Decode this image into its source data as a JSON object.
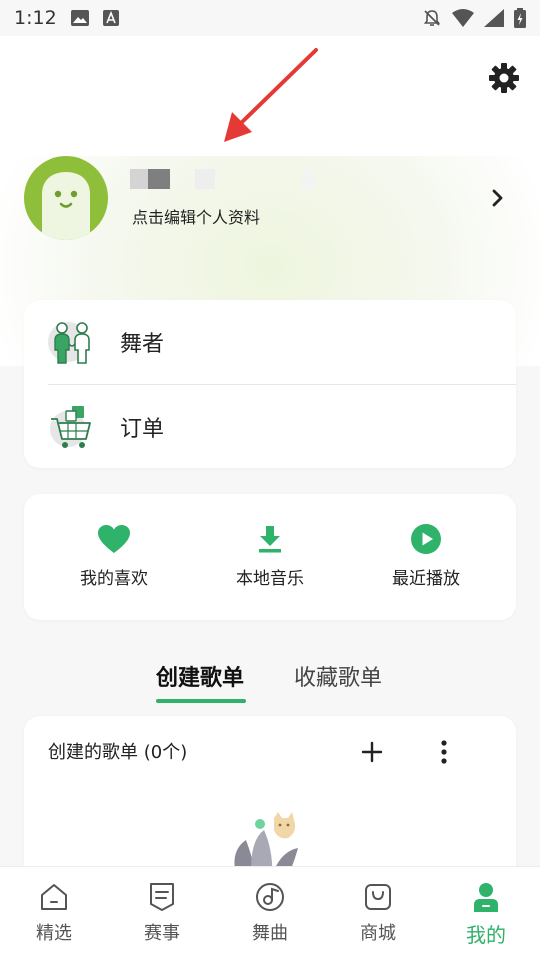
{
  "status_bar": {
    "time": "1:12"
  },
  "profile": {
    "subtitle": "点击编辑个人资料"
  },
  "list_card": {
    "items": [
      {
        "label": "舞者"
      },
      {
        "label": "订单"
      }
    ]
  },
  "quick_actions": [
    {
      "label": "我的喜欢"
    },
    {
      "label": "本地音乐"
    },
    {
      "label": "最近播放"
    }
  ],
  "playlist_tabs": {
    "active": "创建歌单",
    "inactive": "收藏歌单"
  },
  "playlist_card": {
    "title": "创建的歌单 (0个)"
  },
  "bottom_nav": [
    {
      "label": "精选",
      "icon": "home-icon"
    },
    {
      "label": "赛事",
      "icon": "event-icon"
    },
    {
      "label": "舞曲",
      "icon": "music-disc-icon"
    },
    {
      "label": "商城",
      "icon": "shop-bag-icon"
    },
    {
      "label": "我的",
      "icon": "profile-icon",
      "active": true
    }
  ],
  "colors": {
    "accent": "#2fb26a",
    "avatar": "#8fbf3a",
    "annotation_arrow": "#e53935"
  }
}
